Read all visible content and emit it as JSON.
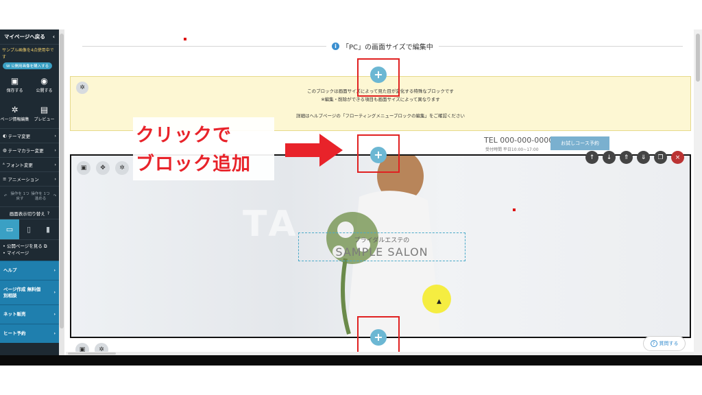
{
  "sidebar": {
    "back_label": "マイページへ戻る",
    "sample_text": "サンプル画像を4点使用中です",
    "badge_text": "W 公開用画像を購入する",
    "actions": [
      {
        "label": "保存する",
        "icon": "save-icon"
      },
      {
        "label": "公開する",
        "icon": "globe-icon"
      },
      {
        "label": "ページ情報編集",
        "icon": "gear-icon"
      },
      {
        "label": "プレビュー",
        "icon": "preview-icon"
      }
    ],
    "menu": [
      {
        "label": "テーマ変更",
        "icon": "theme-icon"
      },
      {
        "label": "テーマカラー変更",
        "icon": "palette-icon"
      },
      {
        "label": "フォント変更",
        "icon": "font-icon"
      },
      {
        "label": "アニメーション",
        "icon": "animation-icon"
      }
    ],
    "undo_label": "操作を 1つ戻す",
    "redo_label": "操作を 1つ進める",
    "view_switch_label": "画面表示切り替え",
    "links": [
      "公開ページを見る",
      "マイページ"
    ],
    "blue_items": [
      "ヘルプ",
      "ページ作成 無料個別相談",
      "ネット販売",
      "ヒート予約"
    ]
  },
  "canvas": {
    "pc_label": "「PC」の画面サイズで編集中",
    "notice_line1": "このブロックは画面サイズによって見た目が変化する特殊なブロックです",
    "notice_line2": "※編集・削除ができる項目も画面サイズによって異なります",
    "notice_line3": "詳細はヘルプページの「フローティングメニューブロックの編集」をご確認ください",
    "tel": "TEL 000-000-0000",
    "hours": "受付時間 平日10:00~17:00",
    "trial_button": "お試しコース予約",
    "hero_subtitle": "ブライダルエステの",
    "hero_title": "SAMPLE SALON",
    "watermark": "TA",
    "help_button": "質問する"
  },
  "annotation": {
    "line1": "クリックで",
    "line2": "ブロック追加"
  },
  "colors": {
    "sidebar_bg": "#1e2a33",
    "accent_blue": "#1f7fae",
    "plus_button": "#6cb7d3",
    "annotation_red": "#e8232a",
    "notice_bg": "#fdf7d3"
  }
}
